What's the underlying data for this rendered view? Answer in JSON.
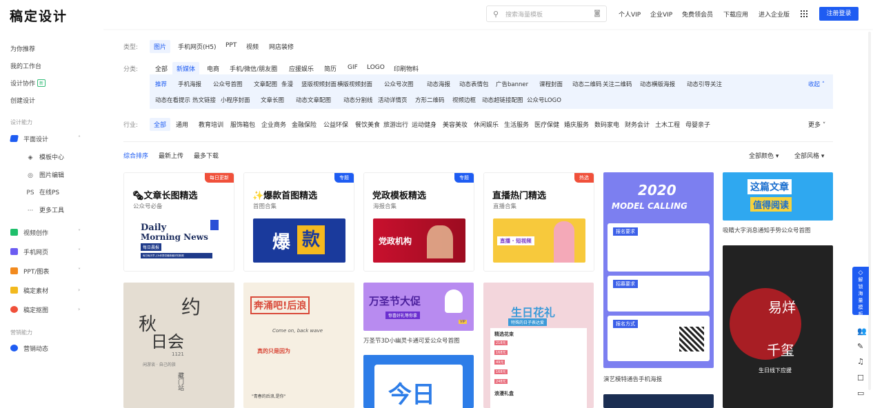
{
  "header": {
    "logo": "稿定设计",
    "search_placeholder": "搜索海量模板",
    "nav": [
      "个人VIP",
      "企业VIP",
      "免费领会员",
      "下载应用",
      "进入企业版"
    ],
    "login": "注册登录"
  },
  "sidebar": {
    "top": [
      "为你推荐",
      "我的工作台",
      "设计协作",
      "创建设计"
    ],
    "collab_badge": "新",
    "group1": "设计能力",
    "flat_design": "平面设计",
    "subitems": [
      {
        "glyph": "◈",
        "label": "模板中心"
      },
      {
        "glyph": "◎",
        "label": "图片编辑"
      },
      {
        "glyph": "PS",
        "label": "在线PS"
      },
      {
        "glyph": "···",
        "label": "更多工具"
      }
    ],
    "items": [
      "视频创作",
      "手机网页",
      "PPT/图表",
      "稿定素材",
      "稿定抠图"
    ],
    "group2": "营销能力",
    "marketing": "营销动态"
  },
  "filters": {
    "type_label": "类型:",
    "types": [
      "图片",
      "手机网页(H5)",
      "PPT",
      "视频",
      "网店装修"
    ],
    "cat_label": "分类:",
    "cats": [
      "全部",
      "新媒体",
      "电商",
      "手机/微信/朋友圈",
      "应援娱乐",
      "简历",
      "GIF",
      "LOGO",
      "印刷物料"
    ],
    "sub_row1": [
      "推荐",
      "手机海报",
      "公众号首图",
      "文章配图",
      "条漫",
      "竖版视频封面",
      "横版视频封面",
      "公众号次图",
      "动态海报",
      "动态表情包",
      "广告banner",
      "课程封面",
      "动态二维码",
      "关注二维码",
      "动态横版海报",
      "动态引导关注"
    ],
    "sub_row2": [
      "动态在看提示",
      "热文链接",
      "小程序封面",
      "文章长图",
      "动态文章配图",
      "动态分割线",
      "活动详情页",
      "方形二维码",
      "视频边框",
      "动态超链接配图",
      "公众号LOGO"
    ],
    "collapse": "收起 ˄",
    "ind_label": "行业:",
    "industries": [
      "全部",
      "通用",
      "教育培训",
      "服饰箱包",
      "企业商务",
      "金融保险",
      "公益环保",
      "餐饮美食",
      "旅游出行",
      "运动健身",
      "美容美妆",
      "休闲娱乐",
      "生活服务",
      "医疗保健",
      "婚庆服务",
      "数码家电",
      "财务会计",
      "土木工程",
      "母婴亲子"
    ],
    "more": "更多 ˅"
  },
  "sort": {
    "options": [
      "综合排序",
      "最新上传",
      "最多下载"
    ],
    "color": "全部颜色 ▾",
    "style": "全部风格 ▾"
  },
  "cards": [
    {
      "title": "🗞文章长图精选",
      "sub": "公众号必备",
      "badge": "每日更新",
      "badge_color": "#f0503a",
      "img_title": "Daily",
      "img_sub": "Morning News",
      "img_tag": "每日晨报",
      "img_line": "每日每天早上为你提供最新最好的新闻"
    },
    {
      "title": "✨爆款首图精选",
      "sub": "首图合集",
      "badge": "专题",
      "badge_color": "#1e5cf2",
      "img_a": "爆",
      "img_b": "款"
    },
    {
      "title": "党政模板精选",
      "sub": "海报合集",
      "badge": "专题",
      "badge_color": "#1e5cf2",
      "img_text": "党政机构"
    },
    {
      "title": "直播热门精选",
      "sub": "直播合集",
      "badge": "热选",
      "badge_color": "#f0503a",
      "img_text": "直播 · 短视频"
    }
  ],
  "thumbs": {
    "t1_a": "约",
    "t1_b": "秋",
    "t1_c": "日会",
    "t1_d": "1121",
    "t1_e": "闲游谈 · 自己的旅",
    "t1_f": "藏门站",
    "t2_a": "奔涌吧!后浪",
    "t2_b": "Come on, back wave",
    "t2_c": "真的只是因为",
    "t2_d": "\"青春的后浪,是你\"",
    "t3_a": "万圣节大促",
    "t3_b": "惊喜好礼等你拿",
    "t3_c": "VIP",
    "t3_cap": "万圣节3D小幽灵卡通可爱公众号首图",
    "t4_a": "生日花礼",
    "t4_b": "特殊的日子表达爱",
    "t4_c": "精选花束",
    "t4_d": "浪漫礼盒",
    "t4_prices": [
      "218元",
      "168元",
      "49元",
      "168元",
      "248元"
    ],
    "t5_a": "2020",
    "t5_b": "MODEL CALLING",
    "t5_c": "报名要求",
    "t5_d": "招募要求",
    "t5_e": "报名方式",
    "t5_cap": "演艺模特通告手机海报",
    "t6_a": "这篇文章",
    "t6_b": "值得阅读",
    "t6_cap": "吸睛大字消息通知手势公众号首图",
    "t7_a": "易烊",
    "t7_b": "千玺",
    "t7_c": "生日线下应援",
    "t8_a": "今日"
  },
  "right_tool": {
    "label": "解锁海量模板"
  },
  "colors": {
    "primary": "#1e5cf2",
    "red_badge": "#f0503a"
  }
}
